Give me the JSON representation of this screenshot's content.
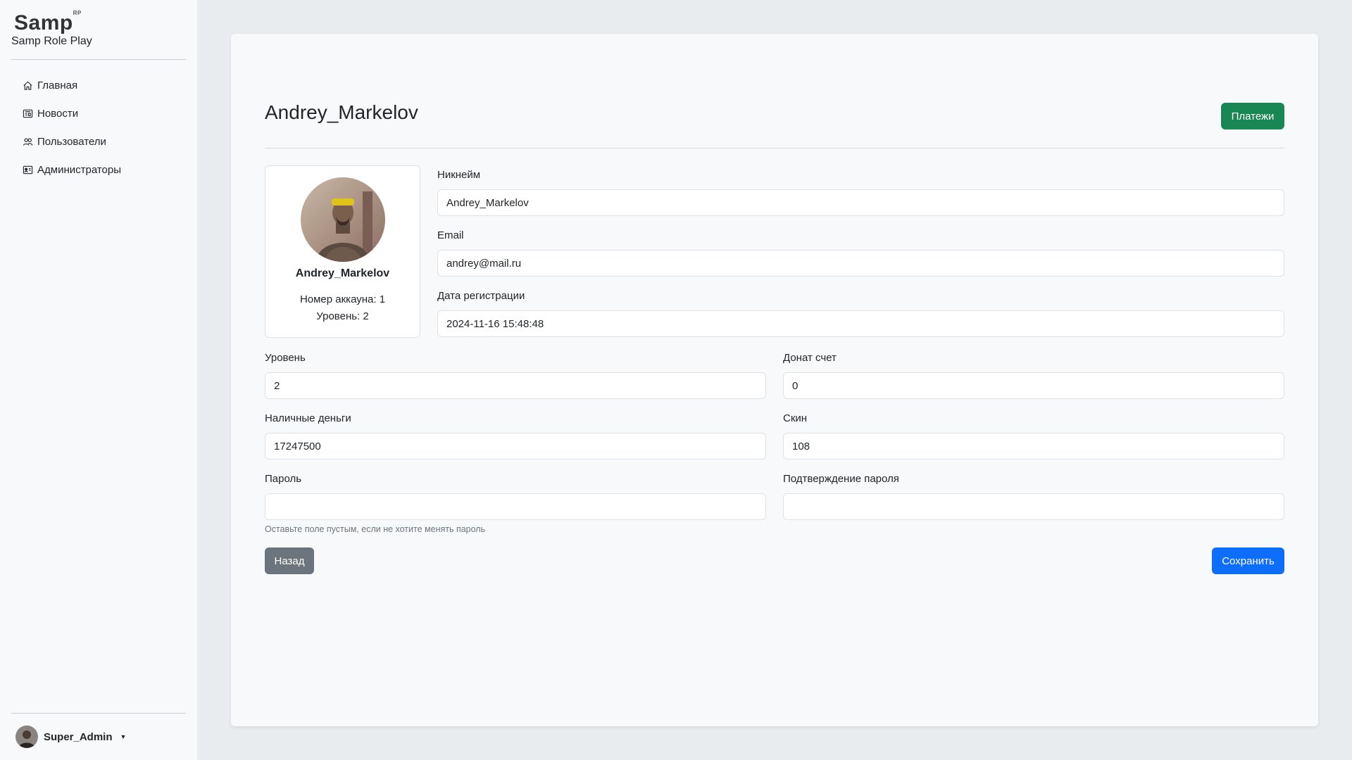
{
  "sidebar": {
    "brand": "Samp",
    "brand_sup": "RP",
    "brand_sub": "Samp Role Play",
    "items": [
      {
        "label": "Главная",
        "icon": "home-icon"
      },
      {
        "label": "Новости",
        "icon": "newspaper-icon"
      },
      {
        "label": "Пользователи",
        "icon": "users-icon"
      },
      {
        "label": "Администраторы",
        "icon": "admin-card-icon"
      }
    ],
    "user": {
      "name": "Super_Admin"
    }
  },
  "page": {
    "title": "Andrey_Markelov",
    "payments_label": "Платежи"
  },
  "profile": {
    "name": "Andrey_Markelov",
    "account_line": "Номер аккауна: 1",
    "level_line": "Уровень: 2"
  },
  "form": {
    "nickname": {
      "label": "Никнейм",
      "value": "Andrey_Markelov"
    },
    "email": {
      "label": "Email",
      "value": "andrey@mail.ru"
    },
    "reg_date": {
      "label": "Дата регистрации",
      "value": "2024-11-16 15:48:48"
    },
    "level": {
      "label": "Уровень",
      "value": "2"
    },
    "donate": {
      "label": "Донат счет",
      "value": "0"
    },
    "cash": {
      "label": "Наличные деньги",
      "value": "17247500"
    },
    "skin": {
      "label": "Скин",
      "value": "108"
    },
    "password": {
      "label": "Пароль",
      "value": ""
    },
    "password_confirm": {
      "label": "Подтверждение пароля",
      "value": ""
    },
    "password_help": "Оставьте поле пустым, если не хотите менять пароль",
    "back_label": "Назад",
    "save_label": "Сохранить"
  },
  "colors": {
    "success": "#198754",
    "primary": "#0d6efd",
    "secondary": "#6c757d",
    "background": "#e9ecef"
  }
}
